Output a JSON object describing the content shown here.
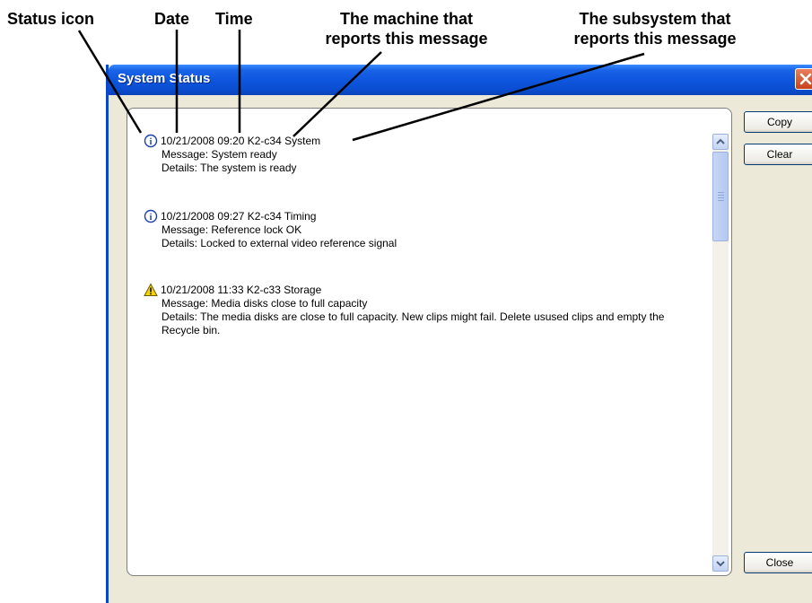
{
  "callouts": {
    "status_icon": "Status icon",
    "date": "Date",
    "time": "Time",
    "machine_line1": "The machine that",
    "machine_line2": "reports this message",
    "subsystem_line1": "The subsystem that",
    "subsystem_line2": "reports this message"
  },
  "window": {
    "title": "System Status",
    "buttons": {
      "copy": "Copy",
      "clear": "Clear",
      "close": "Close"
    }
  },
  "entries": [
    {
      "icon": "info-icon",
      "header": "10/21/2008 09:20 K2-c34 System",
      "message": "Message: System ready",
      "details": "Details: The system is ready"
    },
    {
      "icon": "info-icon",
      "header": "10/21/2008 09:27 K2-c34 Timing",
      "message": "Message: Reference lock OK",
      "details": "Details: Locked to external video reference signal"
    },
    {
      "icon": "warning-icon",
      "header": "10/21/2008 11:33 K2-c33 Storage",
      "message": "Message: Media disks close to full capacity",
      "details": "Details: The media disks are close to full capacity. New clips might fail. Delete usused clips and empty the Recycle bin."
    }
  ],
  "colors": {
    "titlebar": "#0e56de",
    "info_icon": "#1c3fa8",
    "warning_icon": "#f5d400"
  }
}
